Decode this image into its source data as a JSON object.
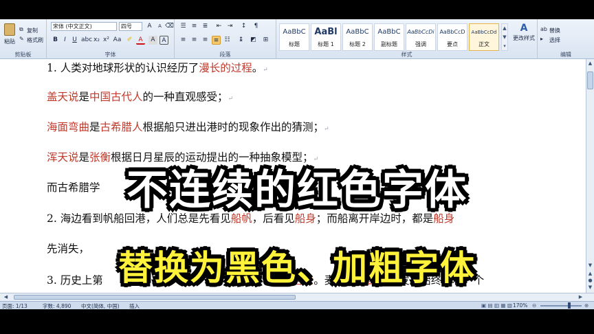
{
  "ribbon": {
    "clipboard": {
      "paste": "粘贴",
      "copy": "复制",
      "format_painter": "格式刷",
      "label": "剪贴板"
    },
    "font": {
      "family": "宋体 (中文正文)",
      "size": "四号",
      "label": "字体"
    },
    "paragraph": {
      "label": "段落"
    },
    "styles": {
      "label": "样式",
      "items": [
        {
          "sample": "AaBbC",
          "name": "标题"
        },
        {
          "sample": "AaBl",
          "name": "标题 1"
        },
        {
          "sample": "AaBbC",
          "name": "标题 2"
        },
        {
          "sample": "AaBbC",
          "name": "副标题"
        },
        {
          "sample": "AaBbCcDi",
          "name": "强调"
        },
        {
          "sample": "AaBbCcD",
          "name": "要点"
        },
        {
          "sample": "AaBbCcDd",
          "name": "正文"
        }
      ],
      "change_styles": "更改样式"
    },
    "editing": {
      "replace": "替换",
      "select": "选择",
      "label": "编辑"
    }
  },
  "document": {
    "line1": {
      "a": "1. 人类对地球形状的认识经历了",
      "b": "漫长的过程",
      "c": "。"
    },
    "line2": {
      "a": "盖天说",
      "b": "是",
      "c": "中国古代人",
      "d": "的一种直观感受；"
    },
    "line3": {
      "a": "海面弯曲",
      "b": "是",
      "c": "古希腊人",
      "d": "根据船只进出港时的现象作出的猜测；"
    },
    "line4": {
      "a": "浑天说",
      "b": "是",
      "c": "张衡",
      "d": "根据日月星辰的运动提出的一种抽象模型；"
    },
    "line5": {
      "a": "而古希腊学"
    },
    "line6": {
      "a": "2. 海边看到帆船回港，人们总是先看见",
      "b": "船帆",
      "c": "，后看见",
      "d": "船身",
      "e": "；而船离开岸边时，都是",
      "f": "船身"
    },
    "line7": {
      "a": "先消失，"
    },
    "line8": {
      "a": "3. 历史上第",
      "b": "麦哲伦",
      "c": "。麦哲伦从",
      "d": "西班",
      "e": "出发后始终朝着一个"
    }
  },
  "status": {
    "page": "页面: 1/13",
    "words": "字数: 4,890",
    "language": "中文(简体, 中国)",
    "mode": "插入",
    "zoom": "170%"
  },
  "overlay": {
    "caption1": "不连续的红色字体",
    "caption2": "替换为黑色、加粗字体"
  },
  "colors": {
    "red_text": "#c0392b",
    "caption1": "#ffffff",
    "caption2": "#fff23a"
  }
}
